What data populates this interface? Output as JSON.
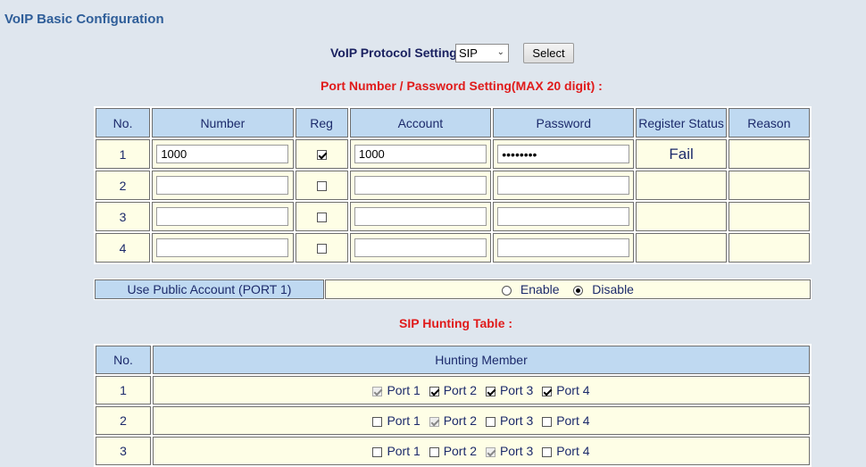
{
  "page": {
    "title": "VoIP Basic Configuration"
  },
  "protocol": {
    "label": "VoIP Protocol Setting",
    "selected": "SIP",
    "button": "Select"
  },
  "port_section": {
    "title": "Port Number / Password Setting(MAX 20 digit) :",
    "headers": [
      "No.",
      "Number",
      "Reg",
      "Account",
      "Password",
      "Register Status",
      "Reason"
    ],
    "rows": [
      {
        "no": "1",
        "number": "1000",
        "reg": true,
        "account": "1000",
        "password": "••••••••",
        "status": "Fail",
        "reason": ""
      },
      {
        "no": "2",
        "number": "",
        "reg": false,
        "account": "",
        "password": "",
        "status": "",
        "reason": ""
      },
      {
        "no": "3",
        "number": "",
        "reg": false,
        "account": "",
        "password": "",
        "status": "",
        "reason": ""
      },
      {
        "no": "4",
        "number": "",
        "reg": false,
        "account": "",
        "password": "",
        "status": "",
        "reason": ""
      }
    ]
  },
  "public_account": {
    "label": "Use Public Account (PORT 1)",
    "enable": "Enable",
    "disable": "Disable",
    "selected": "Disable"
  },
  "hunting": {
    "title": "SIP Hunting Table :",
    "headers": [
      "No.",
      "Hunting Member"
    ],
    "port_labels": [
      "Port 1",
      "Port 2",
      "Port 3",
      "Port 4"
    ],
    "rows": [
      {
        "no": "1",
        "ports": [
          {
            "checked": true,
            "disabled": true
          },
          {
            "checked": true,
            "disabled": false
          },
          {
            "checked": true,
            "disabled": false
          },
          {
            "checked": true,
            "disabled": false
          }
        ]
      },
      {
        "no": "2",
        "ports": [
          {
            "checked": false,
            "disabled": false
          },
          {
            "checked": true,
            "disabled": true
          },
          {
            "checked": false,
            "disabled": false
          },
          {
            "checked": false,
            "disabled": false
          }
        ]
      },
      {
        "no": "3",
        "ports": [
          {
            "checked": false,
            "disabled": false
          },
          {
            "checked": false,
            "disabled": false
          },
          {
            "checked": true,
            "disabled": true
          },
          {
            "checked": false,
            "disabled": false
          }
        ]
      }
    ]
  }
}
